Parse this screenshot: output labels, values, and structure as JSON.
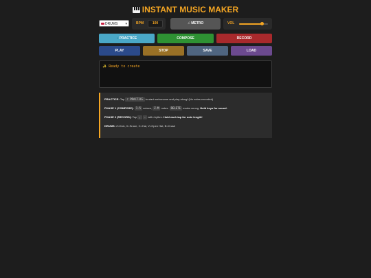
{
  "app": {
    "title": "INSTANT MUSIC MAKER",
    "title_icon": "piano-keys-icon",
    "accent_color": "#f5a623"
  },
  "controls": {
    "instrument": {
      "selected": "DRUMS",
      "icon": "drum-icon"
    },
    "bpm": {
      "label": "BPM",
      "value": "100"
    },
    "metronome": {
      "label": "METRO",
      "icon": "music-note-icon"
    },
    "volume": {
      "label": "VOL",
      "level": 0.8
    }
  },
  "buttons": {
    "practice": {
      "label": "PRACTICE",
      "icon": "music-note-icon",
      "color": "#4aa8c7"
    },
    "compose": {
      "label": "COMPOSE",
      "color": "#2e9233"
    },
    "record": {
      "label": "RECORD",
      "color": "#a8292c"
    },
    "play": {
      "label": "PLAY",
      "color": "#2b4a8a"
    },
    "stop": {
      "label": "STOP",
      "color": "#9a7126"
    },
    "save": {
      "label": "SAVE",
      "color": "#4f6580"
    },
    "load": {
      "label": "LOAD",
      "color": "#6c4a8f"
    }
  },
  "output": {
    "icon": "sparkles-icon",
    "text": "Ready to create"
  },
  "instructions": {
    "practice": {
      "heading": "PRACTICE:",
      "pre": "Tap",
      "key": "PRACTICE",
      "post": "to start metronome and play along! (No notes recorded)"
    },
    "phase1": {
      "heading": "PHASE 1 (COMPOSE):",
      "key1": "1-5",
      "t1": "octave,",
      "key2": "Z-M",
      "t2": "notes.",
      "key3": "DELETE",
      "t3": "marks wrong.",
      "bold": "Hold keys for sound."
    },
    "phase2": {
      "heading": "PHASE 2 (RECORD):",
      "pre": "Tap",
      "key1": ",",
      "key2": ".",
      "t1": "with rhythm.",
      "bold": "Hold each tap for note length!"
    },
    "drums": {
      "heading": "DRUMS:",
      "text": "Z=Kick, X=Snare, C=Hat, V=Open Hat, B=Crash"
    }
  }
}
